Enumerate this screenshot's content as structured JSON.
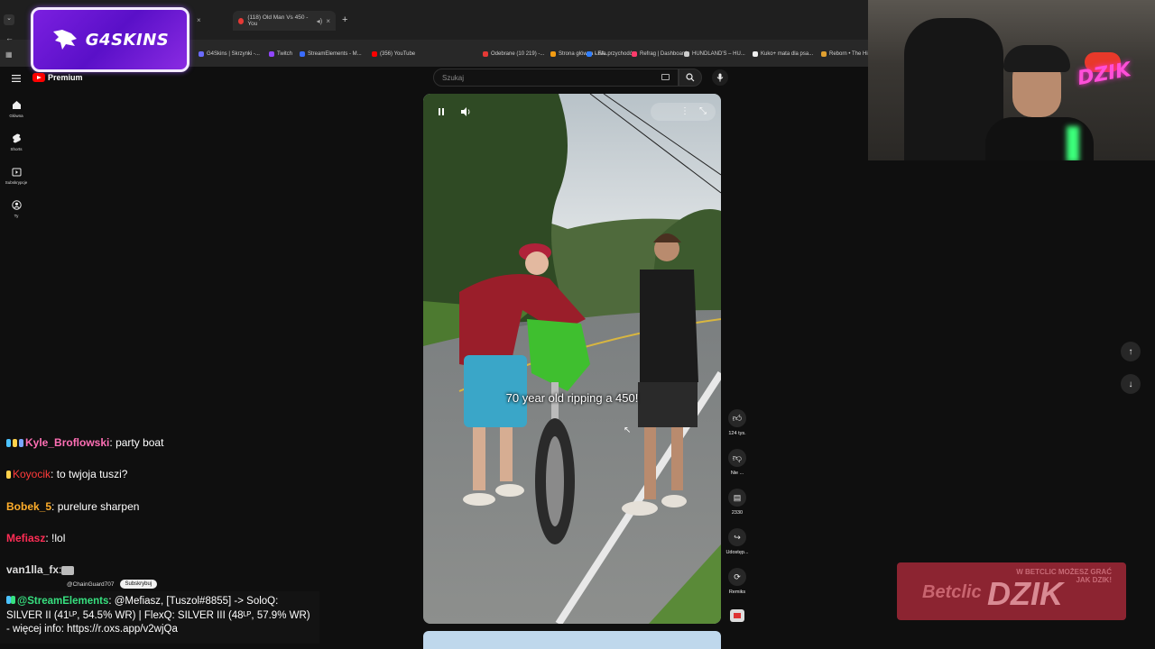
{
  "browser": {
    "tabs": [
      {
        "label": "",
        "active": false
      },
      {
        "label": "(118) Old Man Vs 450 - You",
        "active": true
      }
    ],
    "new_tab": "+",
    "bookmarks": [
      {
        "label": "G4Skins | Skrzynki -...",
        "color": "#6b6bff"
      },
      {
        "label": "Twitch",
        "color": "#9146ff"
      },
      {
        "label": "StreamElements - M...",
        "color": "#3a6cff"
      },
      {
        "label": "(356) YouTube",
        "color": "#ff0000"
      },
      {
        "label": "Odebrane (10 219) -...",
        "color": "#e53935"
      },
      {
        "label": "Strona główna - FA...",
        "color": "#f39c12"
      },
      {
        "label": "Lista przychodów",
        "color": "#2e7dff"
      },
      {
        "label": "Refrag | Dashboard",
        "color": "#ff3b6b"
      },
      {
        "label": "HUNDLAND'S – HU...",
        "color": "#cccccc"
      },
      {
        "label": "Kuko+ mata dla psa...",
        "color": "#eeeeee"
      },
      {
        "label": "Reborn • The Hi...",
        "color": "#e0a030"
      }
    ]
  },
  "logo": {
    "text": "G4SKINS"
  },
  "youtube": {
    "brand": "Premium",
    "search_placeholder": "Szukaj",
    "nav": [
      {
        "label": "Główna",
        "icon": "home-icon"
      },
      {
        "label": "Shorts",
        "icon": "shorts-icon"
      },
      {
        "label": "Subskrypcje",
        "icon": "subscriptions-icon"
      },
      {
        "label": "Ty",
        "icon": "user-icon"
      }
    ],
    "video": {
      "caption": "70 year old ripping a 450!",
      "colors": {
        "sky": "#cfd6dc",
        "trees": "#3d5a2e",
        "road": "#6f7272",
        "bike": "#3fbf2f",
        "shirt": "#9a1e2a",
        "shorts": "#3aa6c8"
      }
    },
    "actions": [
      {
        "label": "124 tys.",
        "icon": "like-icon"
      },
      {
        "label": "Nie ...",
        "icon": "dislike-icon"
      },
      {
        "label": "2330",
        "icon": "comment-icon"
      },
      {
        "label": "Udostęp...",
        "icon": "share-icon"
      },
      {
        "label": "Remiks",
        "icon": "remix-icon"
      }
    ]
  },
  "chat": {
    "messages": [
      {
        "user": "Kyle_Broflowski",
        "sep": ":",
        "text": "party boat",
        "color": "#ff6fb5"
      },
      {
        "user": "Koyocik",
        "sep": ":",
        "text": "to twjoja tuszi?",
        "color": "#ff3b3b"
      },
      {
        "user": "Bobek_5",
        "sep": ":",
        "text": "purelure sharpen",
        "color": "#ffae2b"
      },
      {
        "user": "Mefiasz",
        "sep": ":",
        "text": "!lol",
        "color": "#ff2d55"
      },
      {
        "user": "van1lla_fx",
        "sep": ":",
        "text": "",
        "color": "#dddddd"
      }
    ],
    "youtube_sub": {
      "user": "@ChainGuard707",
      "button": "Subskrybuj"
    },
    "streamelements": {
      "user": "@StreamElements",
      "text": "@Mefiasz, [Tuszol#8855] -> SoloQ: SILVER II (41ᴸᴾ, 54.5% WR) | FlexQ: SILVER III (48ᴸᴾ, 57.9% WR) - więcej info: https://r.oxs.app/v2wjQa"
    }
  },
  "betclic": {
    "slogan_line1": "W BETCLIC MOŻESZ GRAĆ",
    "slogan_line2": "JAK DZIK!",
    "brand": "Betclic",
    "name": "DZIK"
  },
  "cam": {
    "sign": "DZIK"
  }
}
